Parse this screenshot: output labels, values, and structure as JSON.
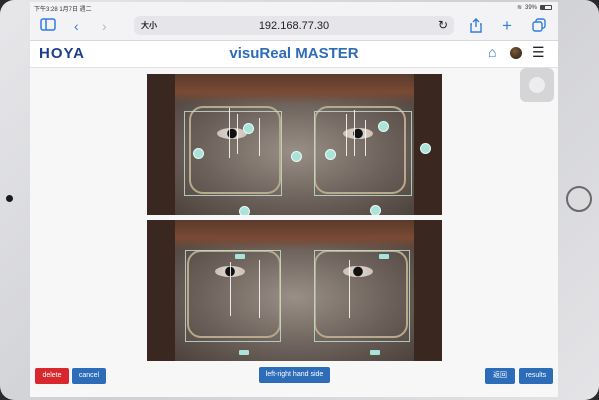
{
  "status_bar": {
    "time_date": "下午3:28  1月7日 週二",
    "battery": "39%",
    "battery_level": 0.39
  },
  "browser": {
    "text_size_label": "大小",
    "url": "192.168.77.30"
  },
  "app": {
    "logo": "HOYA",
    "title": "visuReal MASTER"
  },
  "buttons": {
    "delete": "delete",
    "cancel": "cancel",
    "left_right": "left-right hand side",
    "back": "返回",
    "results": "results"
  },
  "colors": {
    "accent": "#2d6cb8",
    "danger": "#d9272e",
    "logo": "#1d3f8a",
    "marker": "#a9e3da"
  },
  "icons": [
    "sidebar-icon",
    "back-arrow-icon",
    "forward-arrow-icon",
    "reload-icon",
    "share-icon",
    "new-tab-icon",
    "tabs-icon",
    "home-icon",
    "avatar",
    "menu-icon"
  ]
}
